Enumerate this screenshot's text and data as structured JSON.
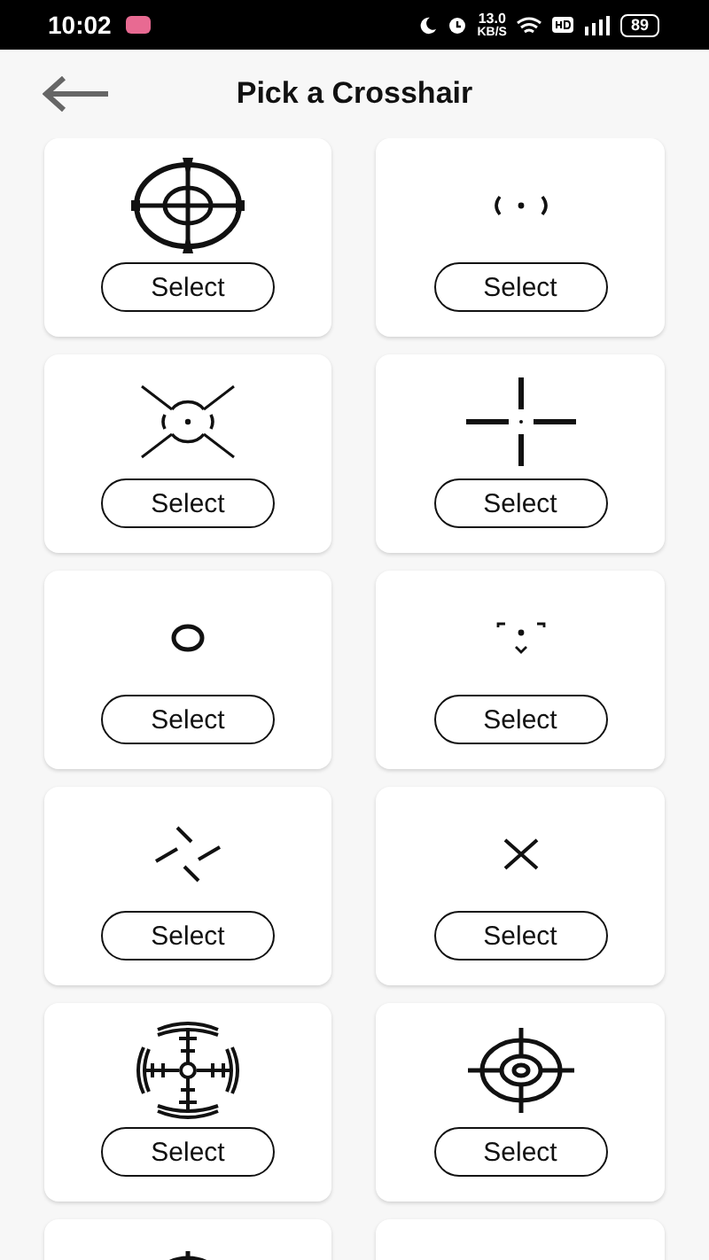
{
  "status_bar": {
    "time": "10:02",
    "speed_value": "13.0",
    "speed_unit": "KB/S",
    "battery": "89"
  },
  "header": {
    "title": "Pick a Crosshair"
  },
  "cards": [
    {
      "kind": "scope",
      "button": "Select"
    },
    {
      "kind": "dot-brackets",
      "button": "Select"
    },
    {
      "kind": "burst",
      "button": "Select"
    },
    {
      "kind": "cross-gap",
      "button": "Select"
    },
    {
      "kind": "ring",
      "button": "Select"
    },
    {
      "kind": "chevrons",
      "button": "Select"
    },
    {
      "kind": "pinwheel",
      "button": "Select"
    },
    {
      "kind": "x",
      "button": "Select"
    },
    {
      "kind": "radar",
      "button": "Select"
    },
    {
      "kind": "target",
      "button": "Select"
    },
    {
      "kind": "circle-cross"
    },
    {
      "kind": "none"
    }
  ]
}
